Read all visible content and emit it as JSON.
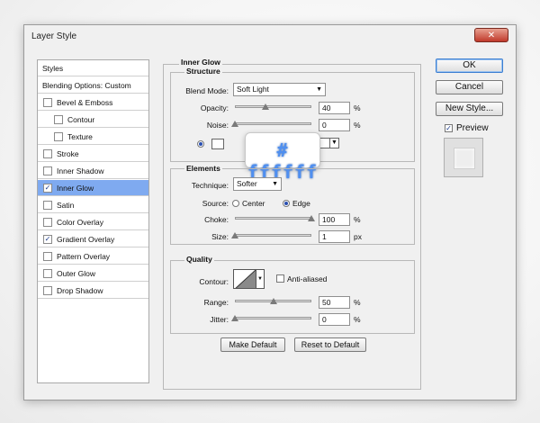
{
  "dialog": {
    "title": "Layer Style",
    "close_icon": "close-icon"
  },
  "left_panel": {
    "items": [
      {
        "label": "Styles",
        "checkbox": false,
        "checked": false,
        "selected": false,
        "indent": 0
      },
      {
        "label": "Blending Options: Custom",
        "checkbox": false,
        "checked": false,
        "selected": false,
        "indent": 0
      },
      {
        "label": "Bevel & Emboss",
        "checkbox": true,
        "checked": false,
        "selected": false,
        "indent": 0
      },
      {
        "label": "Contour",
        "checkbox": true,
        "checked": false,
        "selected": false,
        "indent": 1
      },
      {
        "label": "Texture",
        "checkbox": true,
        "checked": false,
        "selected": false,
        "indent": 1
      },
      {
        "label": "Stroke",
        "checkbox": true,
        "checked": false,
        "selected": false,
        "indent": 0
      },
      {
        "label": "Inner Shadow",
        "checkbox": true,
        "checked": false,
        "selected": false,
        "indent": 0
      },
      {
        "label": "Inner Glow",
        "checkbox": true,
        "checked": true,
        "selected": true,
        "indent": 0
      },
      {
        "label": "Satin",
        "checkbox": true,
        "checked": false,
        "selected": false,
        "indent": 0
      },
      {
        "label": "Color Overlay",
        "checkbox": true,
        "checked": false,
        "selected": false,
        "indent": 0
      },
      {
        "label": "Gradient Overlay",
        "checkbox": true,
        "checked": true,
        "selected": false,
        "indent": 0
      },
      {
        "label": "Pattern Overlay",
        "checkbox": true,
        "checked": false,
        "selected": false,
        "indent": 0
      },
      {
        "label": "Outer Glow",
        "checkbox": true,
        "checked": false,
        "selected": false,
        "indent": 0
      },
      {
        "label": "Drop Shadow",
        "checkbox": true,
        "checked": false,
        "selected": false,
        "indent": 0
      }
    ]
  },
  "inner_glow": {
    "title": "Inner Glow",
    "structure": {
      "title": "Structure",
      "blend_mode_label": "Blend Mode:",
      "blend_mode_value": "Soft Light",
      "opacity_label": "Opacity:",
      "opacity_value": "40",
      "opacity_unit": "%",
      "opacity_fraction": 0.4,
      "noise_label": "Noise:",
      "noise_value": "0",
      "noise_unit": "%",
      "noise_fraction": 0.0,
      "color_hex": "# ffffff",
      "glow_color": "#ffffff"
    },
    "elements": {
      "title": "Elements",
      "technique_label": "Technique:",
      "technique_value": "Softer",
      "source_label": "Source:",
      "source_center": "Center",
      "source_edge": "Edge",
      "source_selected": "Edge",
      "choke_label": "Choke:",
      "choke_value": "100",
      "choke_unit": "%",
      "choke_fraction": 1.0,
      "size_label": "Size:",
      "size_value": "1",
      "size_unit": "px",
      "size_fraction": 0.004
    },
    "quality": {
      "title": "Quality",
      "contour_label": "Contour:",
      "anti_aliased_label": "Anti-aliased",
      "anti_aliased_checked": false,
      "range_label": "Range:",
      "range_value": "50",
      "range_unit": "%",
      "range_fraction": 0.5,
      "jitter_label": "Jitter:",
      "jitter_value": "0",
      "jitter_unit": "%",
      "jitter_fraction": 0.0
    },
    "make_default_label": "Make Default",
    "reset_default_label": "Reset to Default"
  },
  "right_buttons": {
    "ok_label": "OK",
    "cancel_label": "Cancel",
    "new_style_label": "New Style...",
    "preview_label": "Preview",
    "preview_checked": true
  }
}
